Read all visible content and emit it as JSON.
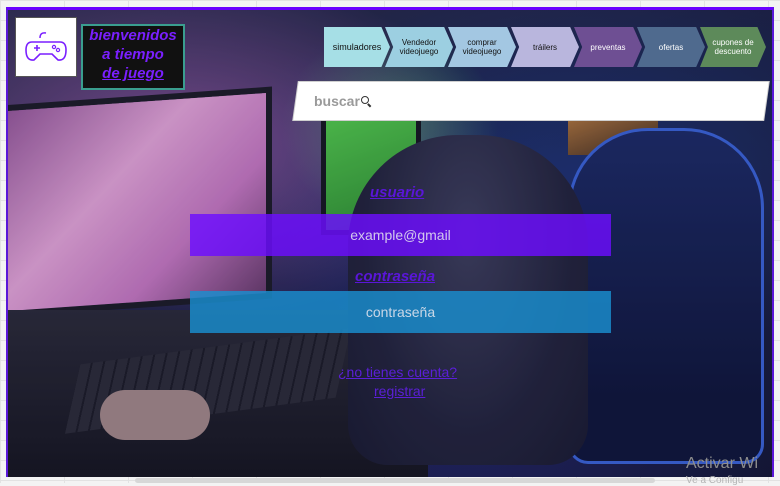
{
  "brand": {
    "lines": [
      "bienvenidos",
      "a tiempo",
      "de juego"
    ]
  },
  "logo": {
    "icon": "gamepad-icon"
  },
  "nav": {
    "items": [
      {
        "label": "simuladores",
        "color": "#a6dfe6"
      },
      {
        "label": "Vendedor videojuego",
        "color": "#9ccfe1"
      },
      {
        "label": "comprar videojuego",
        "color": "#a3c7e2"
      },
      {
        "label": "tráilers",
        "color": "#b9b6dd"
      },
      {
        "label": "preventas",
        "color": "#6e4f93"
      },
      {
        "label": "ofertas",
        "color": "#4f6a8e"
      },
      {
        "label": "cupones de descuento",
        "color": "#5d8a5a"
      }
    ]
  },
  "search": {
    "placeholder": "buscar",
    "icon": "search-icon"
  },
  "login": {
    "user_label": "usuario",
    "email_placeholder": "example@gmail",
    "email_color": "#6d0eff",
    "password_label": "contraseña",
    "password_placeholder": "contraseña",
    "password_color": "#1a8fd0",
    "forgot_link": "¿no tienes cuenta?",
    "register_link": "registrar"
  },
  "watermark": {
    "line1": "Activar Wi",
    "line2": "Ve a Configu"
  }
}
